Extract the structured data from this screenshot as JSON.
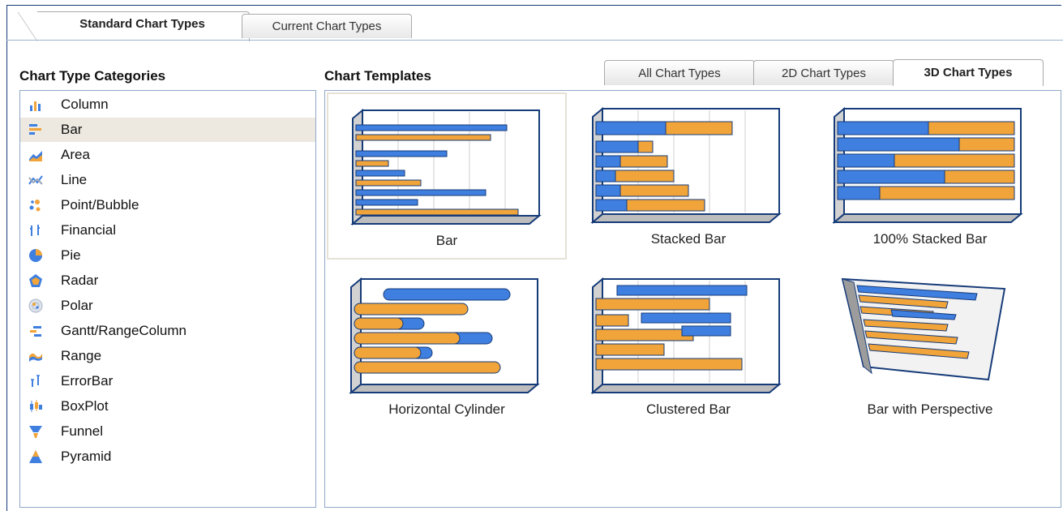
{
  "top_tabs": [
    "Standard Chart Types",
    "Current Chart Types"
  ],
  "categories_title": "Chart Type Categories",
  "templates_title": "Chart Templates",
  "sub_tabs": [
    "All Chart Types",
    "2D Chart Types",
    "3D Chart Types"
  ],
  "categories": [
    {
      "label": "Column",
      "icon": "column-chart-icon"
    },
    {
      "label": "Bar",
      "icon": "bar-chart-icon",
      "selected": true
    },
    {
      "label": "Area",
      "icon": "area-chart-icon"
    },
    {
      "label": "Line",
      "icon": "line-chart-icon"
    },
    {
      "label": "Point/Bubble",
      "icon": "point-bubble-chart-icon"
    },
    {
      "label": "Financial",
      "icon": "financial-chart-icon"
    },
    {
      "label": "Pie",
      "icon": "pie-chart-icon"
    },
    {
      "label": "Radar",
      "icon": "radar-chart-icon"
    },
    {
      "label": "Polar",
      "icon": "polar-chart-icon"
    },
    {
      "label": "Gantt/RangeColumn",
      "icon": "gantt-chart-icon"
    },
    {
      "label": "Range",
      "icon": "range-chart-icon"
    },
    {
      "label": "ErrorBar",
      "icon": "errorbar-chart-icon"
    },
    {
      "label": "BoxPlot",
      "icon": "boxplot-chart-icon"
    },
    {
      "label": "Funnel",
      "icon": "funnel-chart-icon"
    },
    {
      "label": "Pyramid",
      "icon": "pyramid-chart-icon"
    }
  ],
  "templates": [
    {
      "label": "Bar",
      "selected": true
    },
    {
      "label": "Stacked Bar"
    },
    {
      "label": "100% Stacked Bar"
    },
    {
      "label": "Horizontal Cylinder"
    },
    {
      "label": "Clustered Bar"
    },
    {
      "label": "Bar with Perspective"
    }
  ],
  "colors": {
    "blue": "#3f7fe0",
    "orange": "#f0a43a",
    "border": "#163b79"
  }
}
